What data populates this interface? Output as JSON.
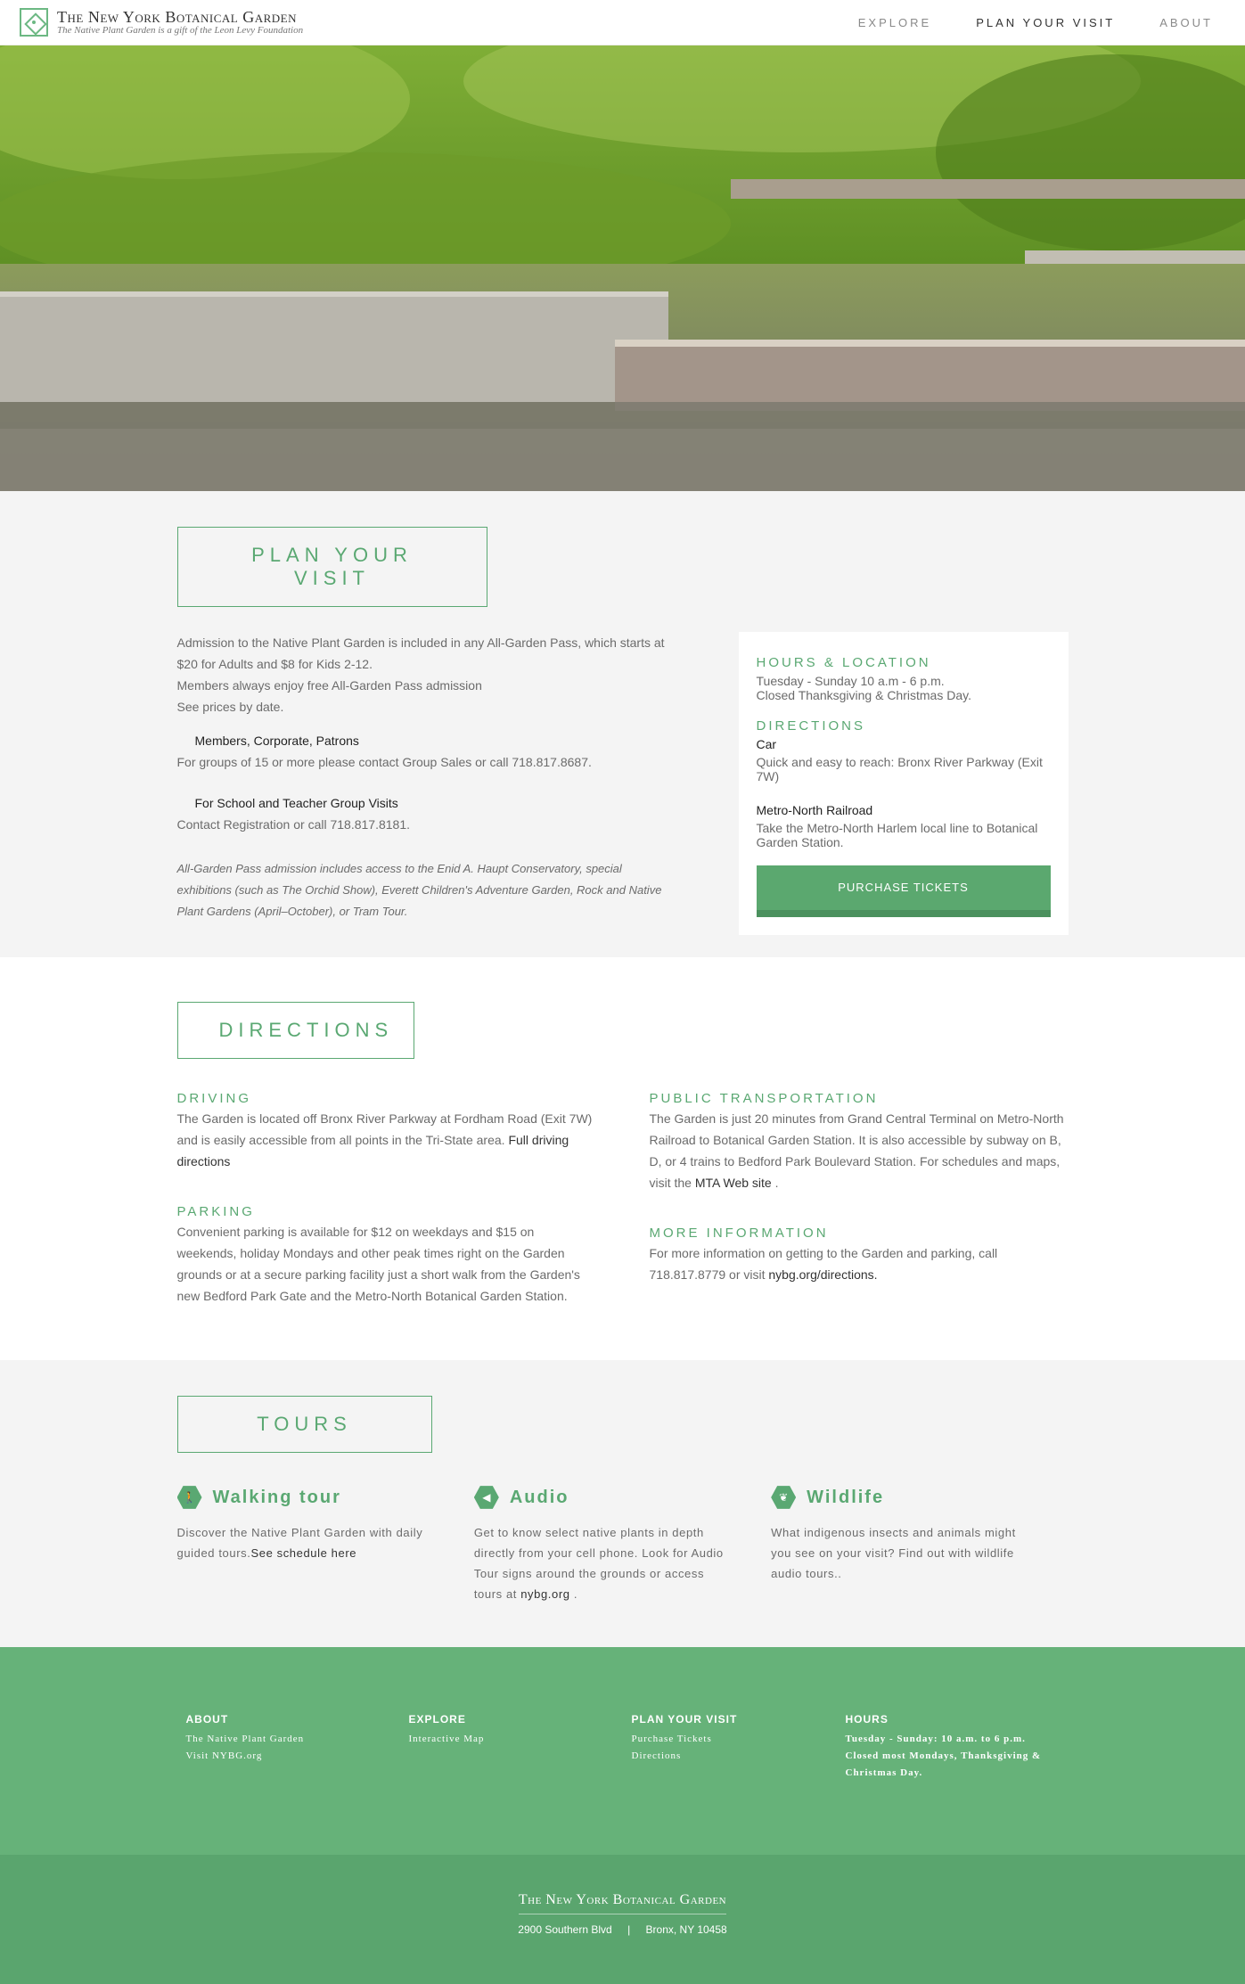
{
  "header": {
    "brand_title": "The New York Botanical Garden",
    "brand_tagline": "The Native Plant Garden is a gift of the Leon Levy Foundation",
    "nav": [
      {
        "label": "EXPLORE"
      },
      {
        "label": "PLAN YOUR VISIT"
      },
      {
        "label": "ABOUT"
      }
    ]
  },
  "plan": {
    "heading": "PLAN YOUR VISIT",
    "admission_1": "Admission to the Native Plant Garden is included in any All-Garden Pass, which starts at $20 for Adults and $8 for Kids 2-12.",
    "admission_2": "Members always enjoy free All-Garden Pass admission",
    "admission_3": "See prices by date.",
    "group_1_title": "Members, Corporate, Patrons",
    "group_1_text": "For groups of 15 or more please contact Group Sales or call 718.817.8687.",
    "group_2_title": "For School and Teacher Group Visits",
    "group_2_text": "Contact Registration or call 718.817.8181.",
    "note": "All-Garden Pass admission includes access to the Enid A. Haupt Conservatory, special exhibitions (such as The Orchid Show), Everett Children's Adventure Garden, Rock and Native Plant Gardens (April–October), or Tram Tour."
  },
  "card": {
    "hours_heading": "HOURS & LOCATION",
    "hours_1": "Tuesday - Sunday 10 a.m - 6 p.m.",
    "hours_2": "Closed Thanksgiving & Christmas Day.",
    "directions_heading": "DIRECTIONS",
    "car_title": "Car",
    "car_text": "Quick and easy to reach: Bronx River Parkway (Exit 7W)",
    "rail_title": "Metro-North Railroad",
    "rail_text": "Take the Metro-North Harlem local line to Botanical Garden Station.",
    "button": "PURCHASE TICKETS"
  },
  "directions": {
    "heading": "DIRECTIONS",
    "driving_h": "DRIVING",
    "driving_text": "The Garden is located off Bronx River Parkway at Fordham Road (Exit 7W) and is easily accessible from all points in the Tri-State area.",
    "driving_link": "Full driving directions",
    "parking_h": "PARKING",
    "parking_text": "Convenient parking is available for $12 on weekdays and $15 on weekends, holiday Mondays and other peak times right on the Garden grounds or at a secure parking facility just a short walk from the Garden's new Bedford Park Gate and the Metro-North Botanical Garden Station.",
    "public_h": "PUBLIC TRANSPORTATION",
    "public_text": "The Garden is just 20 minutes from Grand Central Terminal on Metro-North Railroad to Botanical Garden Station. It is also accessible by subway on B, D, or 4 trains to Bedford Park Boulevard Station. For schedules and maps, visit the",
    "public_link": "MTA Web site",
    "public_end": ".",
    "more_h": "MORE INFORMATION",
    "more_text": "For more information on getting to the Garden and parking, call 718.817.8779 or visit",
    "more_link": "nybg.org/directions."
  },
  "tours": {
    "heading": "TOURS",
    "items": [
      {
        "title": "Walking tour",
        "text": "Discover the Native Plant Garden with daily guided tours.",
        "link": "See schedule here",
        "end": "",
        "icon": "walking-icon"
      },
      {
        "title": "Audio",
        "text": "Get to know select native plants in depth directly from your cell phone. Look for Audio Tour signs around the grounds or access tours at",
        "link": "nybg.org",
        "end": " .",
        "icon": "speaker-icon"
      },
      {
        "title": "Wildlife",
        "text": "What indigenous insects and animals might you see on your visit? Find out with wildlife audio tours..",
        "link": "",
        "end": "",
        "icon": "bird-icon"
      }
    ]
  },
  "footer": {
    "about_h": "ABOUT",
    "about_links": [
      "The Native Plant Garden",
      "Visit NYBG.org"
    ],
    "explore_h": "EXPLORE",
    "explore_links": [
      "Interactive Map"
    ],
    "plan_h": "PLAN YOUR VISIT",
    "plan_links": [
      "Purchase Tickets",
      "Directions"
    ],
    "hours_h": "HOURS",
    "hours_text": "Tuesday - Sunday: 10 a.m. to 6 p.m. Closed most Mondays, Thanksgiving & Christmas Day.",
    "bottom_title": "The New York Botanical Garden",
    "address_1": "2900 Southern Blvd",
    "address_2": "Bronx, NY 10458"
  },
  "colors": {
    "accent": "#5aa872",
    "footer": "#66b279",
    "footer_bottom": "#5aa56e",
    "section_bg": "#f4f4f4"
  }
}
